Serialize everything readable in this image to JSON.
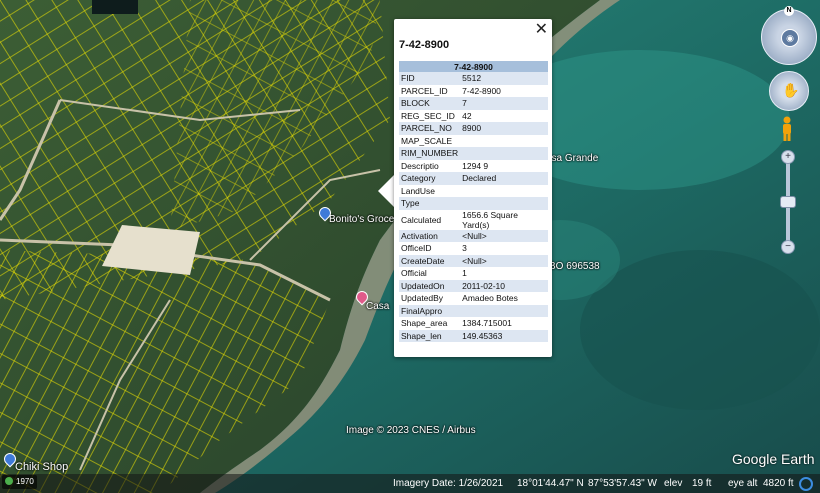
{
  "popup": {
    "title": "7-42-8900",
    "table_header": "7-42-8900",
    "close_glyph": "✕",
    "attributes": [
      {
        "key": "FID",
        "value": "5512"
      },
      {
        "key": "PARCEL_ID",
        "value": "7-42-8900"
      },
      {
        "key": "BLOCK",
        "value": "7"
      },
      {
        "key": "REG_SEC_ID",
        "value": "42"
      },
      {
        "key": "PARCEL_NO",
        "value": "8900"
      },
      {
        "key": "MAP_SCALE",
        "value": ""
      },
      {
        "key": "RIM_NUMBER",
        "value": ""
      },
      {
        "key": "Descriptio",
        "value": "1294 9"
      },
      {
        "key": "Category",
        "value": "Declared"
      },
      {
        "key": "LandUse",
        "value": ""
      },
      {
        "key": "Type",
        "value": ""
      },
      {
        "key": "Calculated",
        "value": "1656.6 Square Yard(s)"
      },
      {
        "key": "Activation",
        "value": "<Null>"
      },
      {
        "key": "OfficeID",
        "value": "3"
      },
      {
        "key": "CreateDate",
        "value": "<Null>"
      },
      {
        "key": "Official",
        "value": "1"
      },
      {
        "key": "UpdatedOn",
        "value": "2011-02-10"
      },
      {
        "key": "UpdatedBy",
        "value": "Amadeo Botes"
      },
      {
        "key": "FinalAppro",
        "value": ""
      },
      {
        "key": "Shape_area",
        "value": "1384.715001"
      },
      {
        "key": "Shape_len",
        "value": "149.45363"
      }
    ]
  },
  "map_labels": {
    "bonitos": "Bonito's Groce",
    "casa_grande": "asa Grande",
    "casa": "Casa",
    "bo_number": "BO 696538",
    "chiki_shop": "Chiki Shop"
  },
  "attribution": {
    "copyright": "Image © 2023 CNES / Airbus",
    "logo": "Google Earth"
  },
  "statusbar": {
    "year": "1970",
    "imagery_date": "Imagery Date: 1/26/2021",
    "lat": "18°01'44.47\" N",
    "lon": "87°53'57.43\" W",
    "elev_label": "elev",
    "elev_value": "19 ft",
    "eye_alt_label": "eye alt",
    "eye_alt_value": "4820 ft"
  },
  "nav": {
    "compass_north": "N",
    "zoom_in": "+",
    "zoom_out": "−"
  },
  "colors": {
    "parcel_lines": "#f2e600",
    "popup_header": "#a6bfdb",
    "popup_alt_row": "#dde6f2",
    "sea": "#1f6f67",
    "land": "#2f4a2b"
  }
}
